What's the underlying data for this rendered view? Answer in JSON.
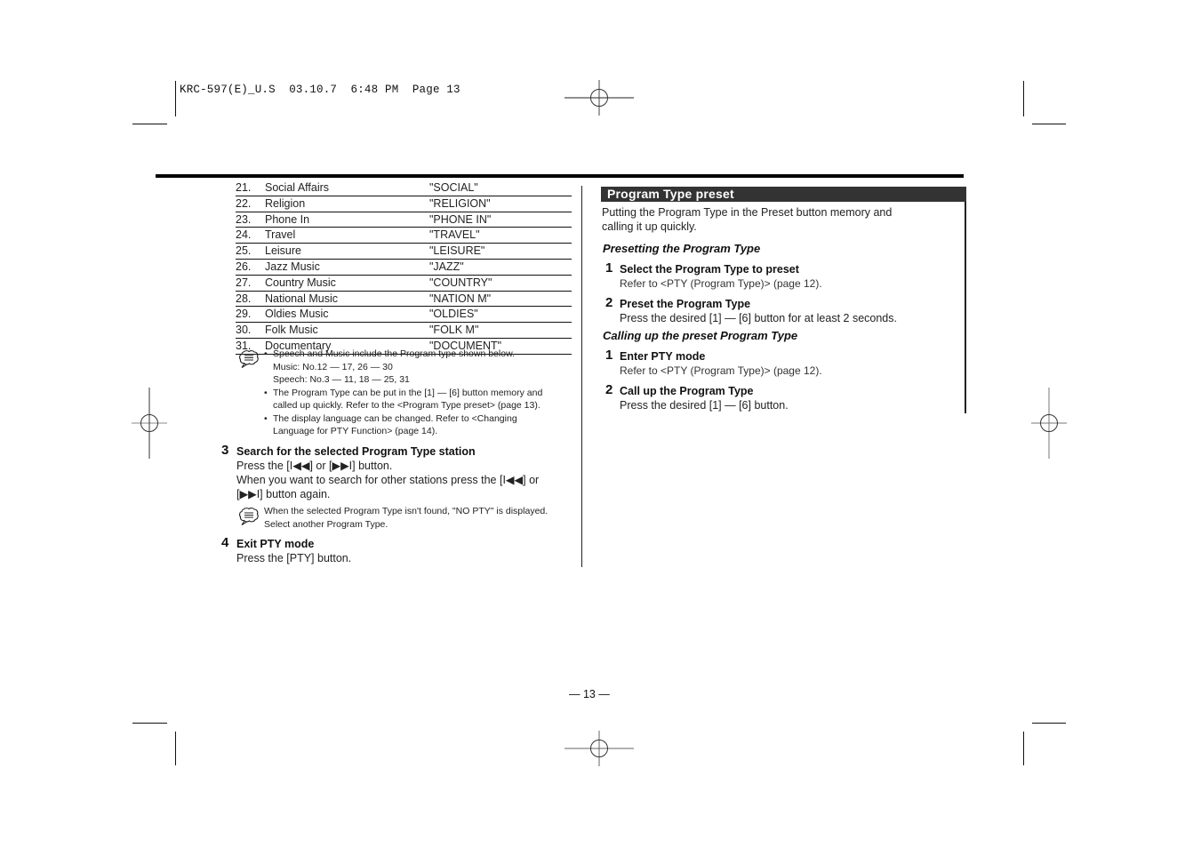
{
  "print_header": {
    "file": "KRC-597(E)_U.S",
    "date": "03.10.7",
    "time": "6:48 PM",
    "page_label": "Page 13",
    "text": "KRC-597(E)_U.S  03.10.7  6:48 PM  Page 13"
  },
  "pty_table": {
    "rows": [
      {
        "num": "21.",
        "name": "Social Affairs",
        "code": "\"SOCIAL\""
      },
      {
        "num": "22.",
        "name": "Religion",
        "code": "\"RELIGION\""
      },
      {
        "num": "23.",
        "name": "Phone In",
        "code": "\"PHONE IN\""
      },
      {
        "num": "24.",
        "name": "Travel",
        "code": "\"TRAVEL\""
      },
      {
        "num": "25.",
        "name": "Leisure",
        "code": "\"LEISURE\""
      },
      {
        "num": "26.",
        "name": "Jazz Music",
        "code": "\"JAZZ\""
      },
      {
        "num": "27.",
        "name": "Country Music",
        "code": "\"COUNTRY\""
      },
      {
        "num": "28.",
        "name": "National Music",
        "code": "\"NATION M\""
      },
      {
        "num": "29.",
        "name": "Oldies Music",
        "code": "\"OLDIES\""
      },
      {
        "num": "30.",
        "name": "Folk Music",
        "code": "\"FOLK M\""
      },
      {
        "num": "31.",
        "name": "Documentary",
        "code": "\"DOCUMENT\""
      }
    ]
  },
  "note1": {
    "icon": "note-speech-bubble-icon",
    "bullets": [
      {
        "line1": "Speech and Music include the Program type shown below.",
        "line2": "Music: No.12 — 17, 26 — 30",
        "line3": "Speech: No.3 — 11, 18 — 25, 31"
      },
      {
        "line1": "The Program Type can be put in the [1] — [6] button memory and",
        "line2": "called up quickly. Refer to the <Program Type preset> (page 13)."
      },
      {
        "line1": "The display language can be changed. Refer to <Changing",
        "line2": "Language for PTY Function> (page 14)."
      }
    ]
  },
  "left_steps": {
    "step3": {
      "num": "3",
      "title": "Search for the selected Program Type station",
      "line1": "Press the [I◀◀] or [▶▶I] button.",
      "line2": "When you want to search for other stations press the [I◀◀] or",
      "line3": "[▶▶I] button again."
    },
    "note2": {
      "icon": "note-speech-bubble-icon",
      "line1": "When the selected Program Type isn't found, \"NO PTY\" is displayed.",
      "line2": "Select another Program Type."
    },
    "step4": {
      "num": "4",
      "title": "Exit PTY mode",
      "line1": "Press the [PTY] button."
    }
  },
  "right_section": {
    "title": "Program Type preset",
    "intro_line1": "Putting the Program Type in the Preset button memory and",
    "intro_line2": "calling it up quickly.",
    "presetting": {
      "heading": "Presetting the Program Type",
      "steps": [
        {
          "num": "1",
          "title": "Select the Program Type to preset",
          "text": "Refer to <PTY (Program Type)> (page 12)."
        },
        {
          "num": "2",
          "title": "Preset the Program Type",
          "text": "Press the desired [1] — [6] button for at least 2 seconds."
        }
      ]
    },
    "calling": {
      "heading": "Calling up the preset Program Type",
      "steps": [
        {
          "num": "1",
          "title": "Enter PTY mode",
          "text": "Refer to <PTY (Program Type)> (page 12)."
        },
        {
          "num": "2",
          "title": "Call up the Program Type",
          "text": "Press the desired [1] — [6] button."
        }
      ]
    }
  },
  "footer": {
    "page_number": "— 13 —"
  }
}
